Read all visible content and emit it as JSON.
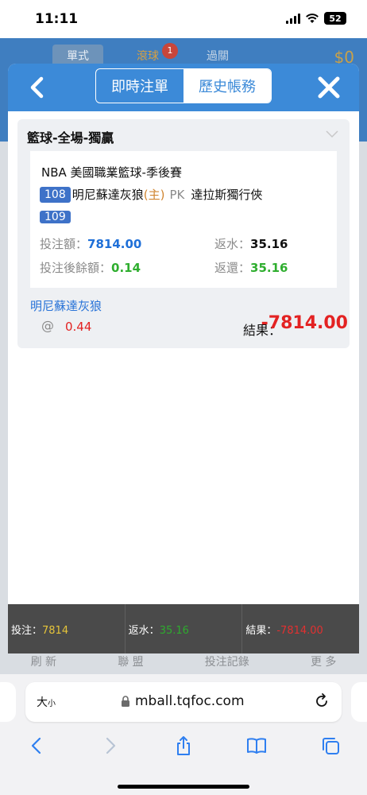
{
  "status_bar": {
    "time": "11:11",
    "battery": "52"
  },
  "background": {
    "tabs": [
      "單式",
      "滾球",
      "過關"
    ],
    "badge": "1",
    "amount": "$0",
    "footer": [
      "刷 新",
      "聯 盟",
      "投注記錄",
      "更 多"
    ]
  },
  "modal": {
    "tabs": [
      {
        "label": "即時注單",
        "active": false
      },
      {
        "label": "歷史帳務",
        "active": true
      }
    ],
    "bet": {
      "type": "籃球-全場-獨贏",
      "match": "NBA 美國職業籃球-季後賽",
      "home_number": "108",
      "home_team": "明尼蘇達灰狼",
      "home_tag": "(主)",
      "vs": "PK",
      "away_team": "達拉斯獨行俠",
      "away_number": "109",
      "stake_label": "投注額：",
      "stake": "7814.00",
      "rebate_label": "返水：",
      "rebate": "35.16",
      "balance_label": "投注後餘額：",
      "balance": "0.14",
      "return_label": "返還：",
      "return": "35.16",
      "selection": "明尼蘇達灰狼",
      "odds_at": "@",
      "odds": "0.44",
      "result_label": "結果：",
      "result": "-7814.00"
    },
    "summary": {
      "stake_label": "投注：",
      "stake": "7814",
      "rebate_label": "返水：",
      "rebate": "35.16",
      "result_label": "結果：",
      "result": "-7814.00"
    }
  },
  "safari": {
    "text_size": "大",
    "text_size_small": "小",
    "url": "mball.tqfoc.com"
  },
  "colors": {
    "header_blue": "#3c8ad8",
    "result_red": "#e32222",
    "positive_green": "#2fae2f",
    "stake_blue": "#1e6fd8"
  }
}
